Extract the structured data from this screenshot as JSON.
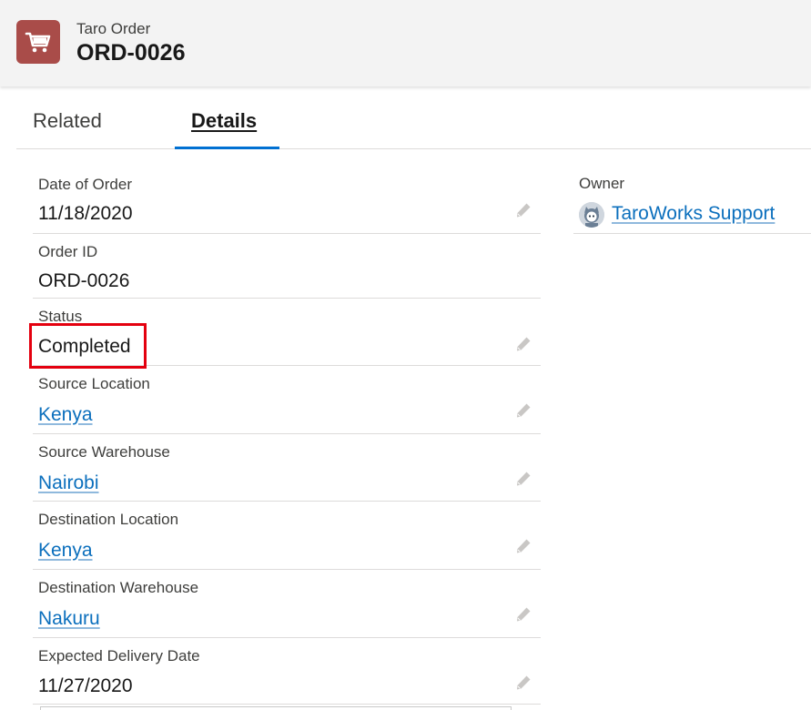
{
  "header": {
    "icon": "cart-icon",
    "object_type": "Taro Order",
    "record_title": "ORD-0026",
    "icon_color": "#a94c49"
  },
  "tabs": [
    {
      "label": "Related",
      "active": false
    },
    {
      "label": "Details",
      "active": true
    }
  ],
  "fields": [
    {
      "label": "Date of Order",
      "value": "11/18/2020",
      "is_link": false,
      "editable": true
    },
    {
      "label": "Order ID",
      "value": "ORD-0026",
      "is_link": false,
      "editable": false
    },
    {
      "label": "Status",
      "value": "Completed",
      "is_link": false,
      "editable": true
    },
    {
      "label": "Source Location",
      "value": "Kenya",
      "is_link": true,
      "editable": true
    },
    {
      "label": "Source Warehouse",
      "value": "Nairobi",
      "is_link": true,
      "editable": true
    },
    {
      "label": "Destination Location",
      "value": "Kenya",
      "is_link": true,
      "editable": true
    },
    {
      "label": "Destination Warehouse",
      "value": "Nakuru",
      "is_link": true,
      "editable": true
    },
    {
      "label": "Expected Delivery Date",
      "value": "11/27/2020",
      "is_link": false,
      "editable": true
    }
  ],
  "owner": {
    "label": "Owner",
    "name": "TaroWorks Support",
    "avatar_icon": "astro-avatar-icon"
  },
  "colors": {
    "link": "#0b6fbd",
    "tab_active": "#0070d2",
    "highlight": "#e4000f"
  }
}
